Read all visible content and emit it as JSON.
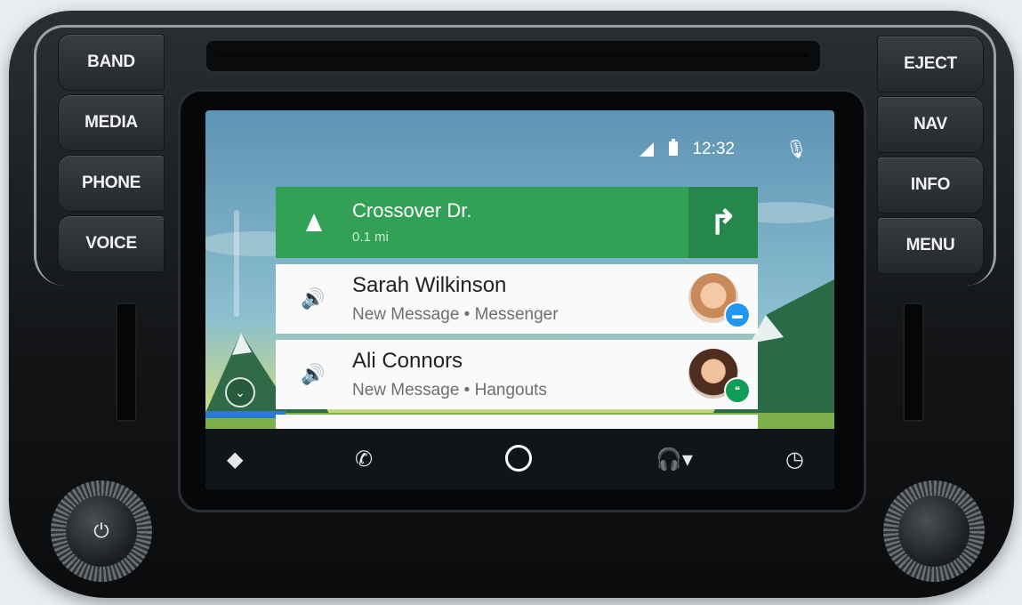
{
  "hardware": {
    "left_buttons": [
      "BAND",
      "MEDIA",
      "PHONE",
      "VOICE"
    ],
    "right_buttons": [
      "EJECT",
      "NAV",
      "INFO",
      "MENU"
    ],
    "power_icon": "⏻"
  },
  "status": {
    "time": "12:32",
    "signal_icon": "cell-signal-icon",
    "battery_icon": "battery-icon",
    "mic_icon": "microphone-icon"
  },
  "navigation_card": {
    "street": "Crossover Dr.",
    "distance": "0.1 mi",
    "turn_icon": "turn-right-icon",
    "color": "#33a155"
  },
  "messages": [
    {
      "name": "Sarah Wilkinson",
      "subtitle": "New Message • Messenger",
      "app_icon": "messenger-icon"
    },
    {
      "name": "Ali Connors",
      "subtitle": "New Message • Hangouts",
      "app_icon": "hangouts-icon"
    }
  ],
  "bottom_nav": [
    "navigation-icon",
    "phone-icon",
    "home-icon",
    "headphones-icon",
    "recents-icon"
  ]
}
